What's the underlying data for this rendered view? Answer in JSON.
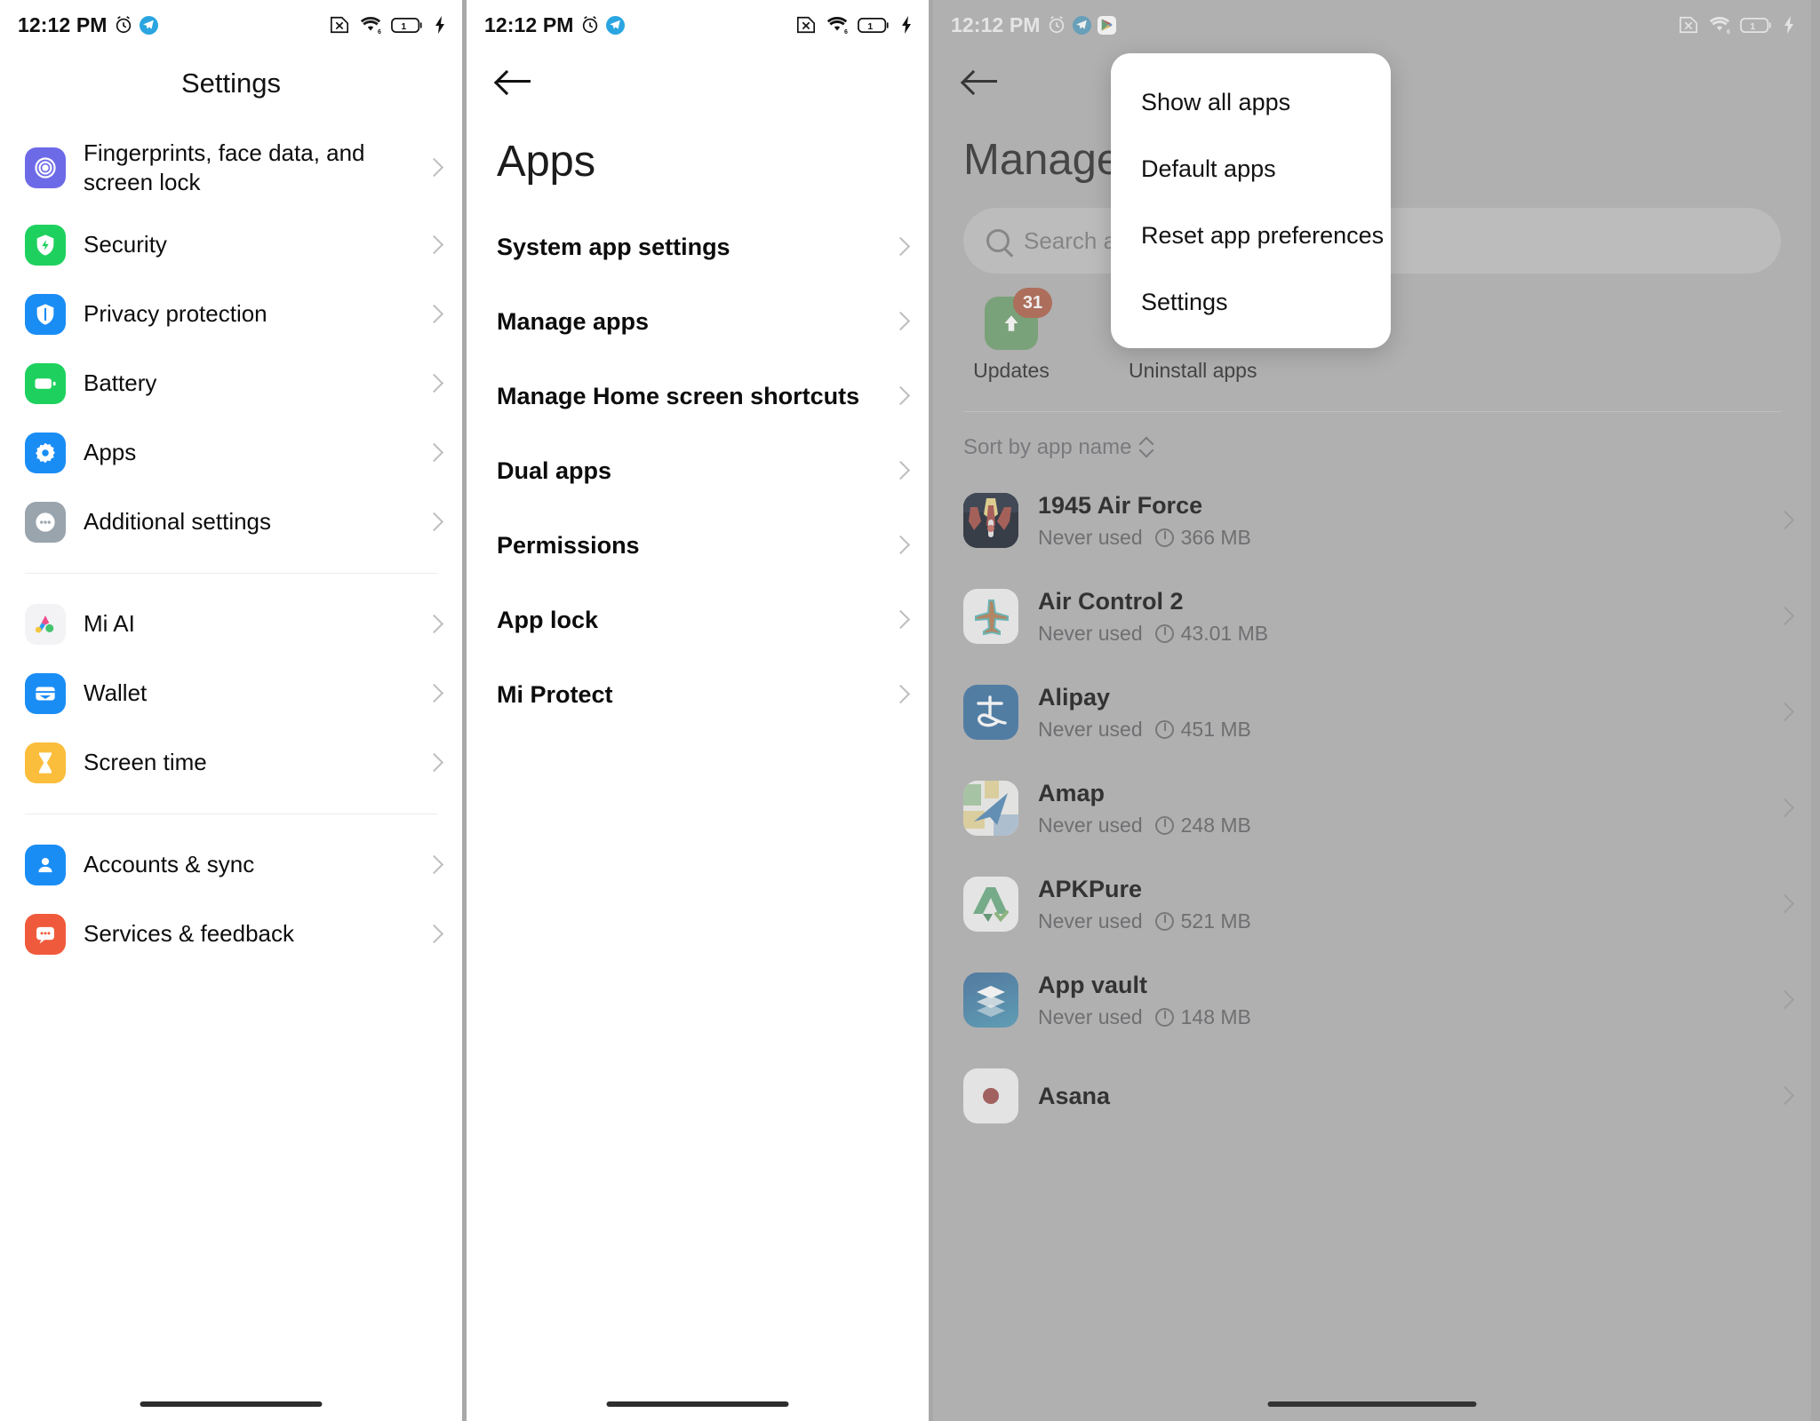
{
  "statusbar": {
    "time": "12:12 PM",
    "icons_left": [
      "alarm-clock-icon",
      "telegram-icon"
    ],
    "icons_left_panel3": [
      "alarm-clock-icon",
      "telegram-icon",
      "google-play-icon"
    ],
    "icons_right": [
      "sim-off-icon",
      "wifi-6-icon",
      "battery-icon",
      "charging-bolt-icon"
    ],
    "battery_level_label": "1"
  },
  "panel1": {
    "title": "Settings",
    "groups": [
      {
        "items": [
          {
            "label": "Fingerprints, face data, and screen lock",
            "icon": "fingerprint-icon",
            "icon_bg": "#6d6ae8"
          },
          {
            "label": "Security",
            "icon": "shield-bolt-icon",
            "icon_bg": "#1ed15e"
          },
          {
            "label": "Privacy protection",
            "icon": "privacy-shield-icon",
            "icon_bg": "#1a8df5"
          },
          {
            "label": "Battery",
            "icon": "battery-icon",
            "icon_bg": "#1ed15e"
          },
          {
            "label": "Apps",
            "icon": "gear-flower-icon",
            "icon_bg": "#1a8df5"
          },
          {
            "label": "Additional settings",
            "icon": "ellipsis-icon",
            "icon_bg": "#9aa4ad"
          }
        ]
      },
      {
        "items": [
          {
            "label": "Mi AI",
            "icon": "mi-ai-icon",
            "icon_bg": "#f3f3f5"
          },
          {
            "label": "Wallet",
            "icon": "wallet-icon",
            "icon_bg": "#1a8df5"
          },
          {
            "label": "Screen time",
            "icon": "hourglass-icon",
            "icon_bg": "#fbbd3c"
          }
        ]
      },
      {
        "items": [
          {
            "label": "Accounts & sync",
            "icon": "person-icon",
            "icon_bg": "#1a8df5"
          },
          {
            "label": "Services & feedback",
            "icon": "feedback-icon",
            "icon_bg": "#f05a3c"
          }
        ]
      }
    ]
  },
  "panel2": {
    "back_icon": "back-arrow-icon",
    "title": "Apps",
    "items": [
      {
        "label": "System app settings"
      },
      {
        "label": "Manage apps"
      },
      {
        "label": "Manage Home screen shortcuts"
      },
      {
        "label": "Dual apps"
      },
      {
        "label": "Permissions"
      },
      {
        "label": "App lock"
      },
      {
        "label": "Mi Protect"
      }
    ]
  },
  "panel3": {
    "back_icon": "back-arrow-icon",
    "title": "Manage apps",
    "search": {
      "placeholder": "Search among installed apps",
      "icon": "search-icon"
    },
    "quick_actions": [
      {
        "label": "Updates",
        "icon": "update-arrow-icon",
        "badge": "31",
        "icon_bg": "#4fab50",
        "badge_color": "#e1512a"
      },
      {
        "label": "Uninstall apps",
        "icon": "uninstall-icon",
        "icon_bg": "#e07c22"
      }
    ],
    "sort": {
      "label": "Sort by app name",
      "icon": "sort-chevrons-icon"
    },
    "apps": [
      {
        "name": "1945 Air Force",
        "used": "Never used",
        "size": "366 MB",
        "icon": "game-1945-icon"
      },
      {
        "name": "Air Control 2",
        "used": "Never used",
        "size": "43.01 MB",
        "icon": "airplane-icon"
      },
      {
        "name": "Alipay",
        "used": "Never used",
        "size": "451 MB",
        "icon": "alipay-icon"
      },
      {
        "name": "Amap",
        "used": "Never used",
        "size": "248 MB",
        "icon": "amap-icon"
      },
      {
        "name": "APKPure",
        "used": "Never used",
        "size": "521 MB",
        "icon": "apkpure-icon"
      },
      {
        "name": "App vault",
        "used": "Never used",
        "size": "148 MB",
        "icon": "app-vault-icon"
      },
      {
        "name": "Asana",
        "used": "",
        "size": "",
        "icon": "asana-icon"
      }
    ],
    "popup_menu": {
      "items": [
        {
          "label": "Show all apps"
        },
        {
          "label": "Default apps"
        },
        {
          "label": "Reset app preferences"
        },
        {
          "label": "Settings"
        }
      ]
    }
  },
  "colors": {
    "accent_blue": "#1a8df5",
    "accent_green": "#1ed15e",
    "badge_red": "#e1512a",
    "dim_overlay": "#b0b0b0"
  }
}
